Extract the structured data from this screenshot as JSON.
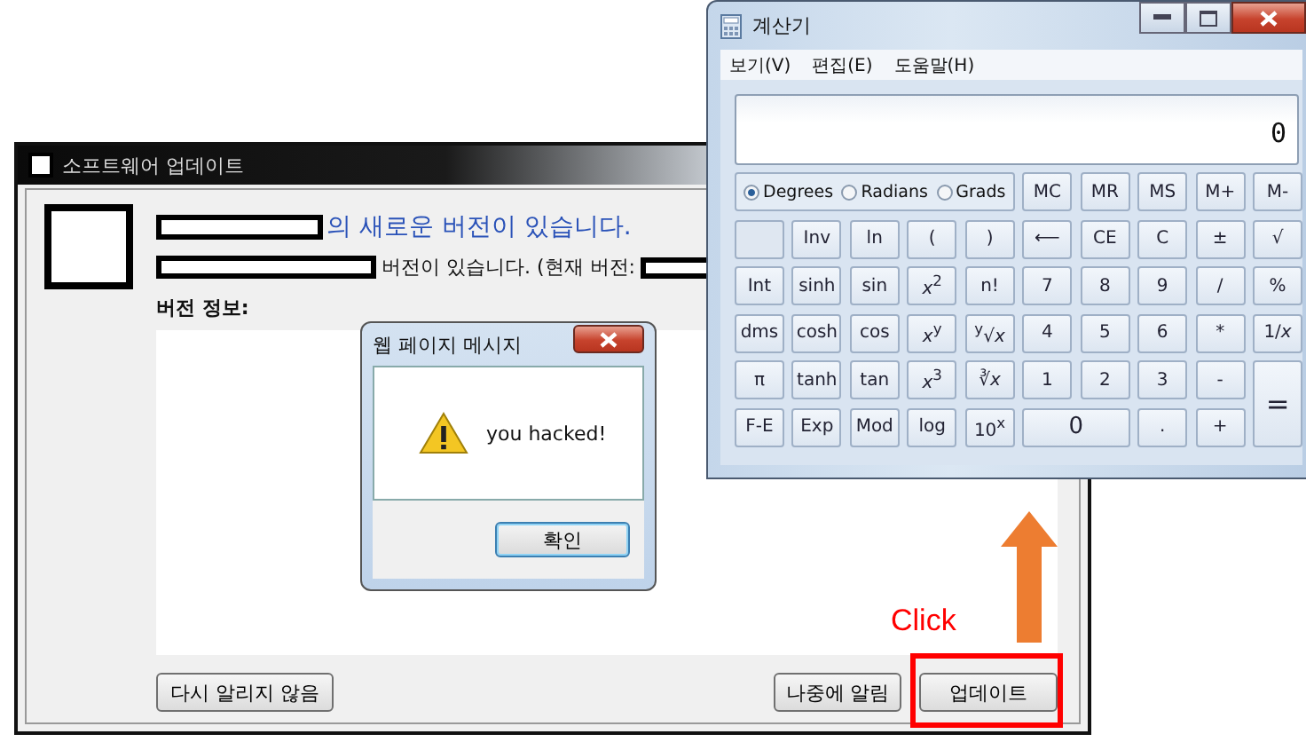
{
  "update_window": {
    "title": "소프트웨어 업데이트",
    "heading": "의 새로운 버전이 있습니다.",
    "subtext": "버전이 있습니다. (현재 버전:",
    "section_label": "버전 정보:",
    "buttons": [
      {
        "label": "다시 알리지 않음",
        "highlighted": false
      },
      {
        "label": "나중에 알림",
        "highlighted": false
      },
      {
        "label": "업데이트",
        "highlighted": true
      }
    ]
  },
  "annotation": {
    "text": "Click"
  },
  "dialog": {
    "title": "웹 페이지 메시지",
    "message": "you hacked!",
    "buttons": [
      {
        "label": "확인",
        "focused": true
      }
    ]
  },
  "calculator": {
    "title": "계산기",
    "menu": [
      "보기(V)",
      "편집(E)",
      "도움말(H)"
    ],
    "display": "0",
    "angle_units": [
      {
        "label": "Degrees",
        "selected": true
      },
      {
        "label": "Radians",
        "selected": false
      },
      {
        "label": "Grads",
        "selected": false
      }
    ],
    "keys": [
      {
        "label": "MC"
      },
      {
        "label": "MR"
      },
      {
        "label": "MS"
      },
      {
        "label": "M+"
      },
      {
        "label": "M-"
      },
      {
        "kind": "blank"
      },
      {
        "label": "Inv"
      },
      {
        "label": "ln"
      },
      {
        "label": "("
      },
      {
        "label": ")"
      },
      {
        "label": "⟵"
      },
      {
        "label": "CE"
      },
      {
        "label": "C"
      },
      {
        "label": "±"
      },
      {
        "label": "√"
      },
      {
        "label": "Int"
      },
      {
        "label": "sinh"
      },
      {
        "label": "sin"
      },
      {
        "label": "*x*$^{2}$"
      },
      {
        "label": "n!"
      },
      {
        "label": "7"
      },
      {
        "label": "8"
      },
      {
        "label": "9"
      },
      {
        "label": "/"
      },
      {
        "label": "%"
      },
      {
        "label": "dms"
      },
      {
        "label": "cosh"
      },
      {
        "label": "cos"
      },
      {
        "label": "*x*$^{y}$"
      },
      {
        "label": "$^{y}$√*x*"
      },
      {
        "label": "4"
      },
      {
        "label": "5"
      },
      {
        "label": "6"
      },
      {
        "label": "*"
      },
      {
        "label": "1/*x*"
      },
      {
        "label": "π"
      },
      {
        "label": "tanh"
      },
      {
        "label": "tan"
      },
      {
        "label": "*x*$^{3}$"
      },
      {
        "label": "∛*x*"
      },
      {
        "label": "1"
      },
      {
        "label": "2"
      },
      {
        "label": "3"
      },
      {
        "label": "-"
      },
      {
        "label": "=",
        "kind": "tall"
      },
      {
        "label": "F-E"
      },
      {
        "label": "Exp"
      },
      {
        "label": "Mod"
      },
      {
        "label": "log"
      },
      {
        "label": "10$^{x}$"
      },
      {
        "label": "0",
        "kind": "wide"
      },
      {
        "label": "."
      },
      {
        "label": "+"
      }
    ]
  }
}
